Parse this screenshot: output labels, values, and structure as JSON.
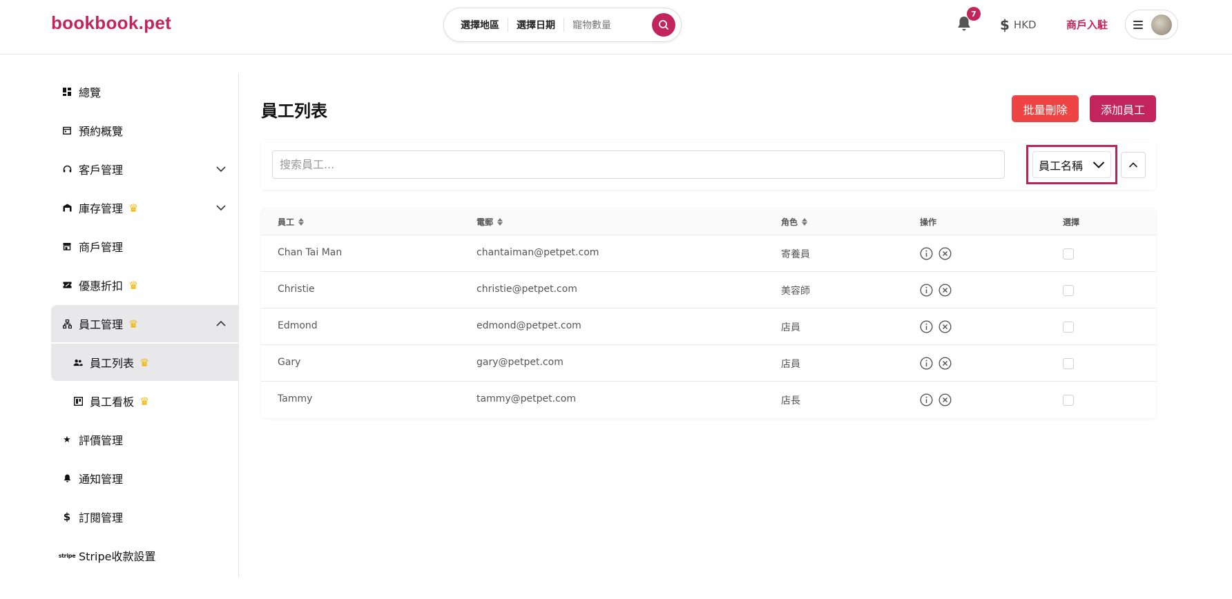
{
  "header": {
    "logo": "bookbook.pet",
    "search": {
      "region": "選擇地區",
      "date": "選擇日期",
      "pets": "寵物數量"
    },
    "notification_count": "7",
    "currency": "HKD",
    "merchant_link": "商戶入駐",
    "search_icon": "search-icon",
    "bell_icon": "bell-icon"
  },
  "sidebar": {
    "items": [
      {
        "label": "總覽",
        "icon": "dashboard-icon"
      },
      {
        "label": "預約概覽",
        "icon": "calendar-icon"
      },
      {
        "label": "客戶管理",
        "icon": "headset-icon"
      },
      {
        "label": "庫存管理",
        "icon": "warehouse-icon"
      },
      {
        "label": "商戶管理",
        "icon": "store-icon"
      },
      {
        "label": "優惠折扣",
        "icon": "ticket-icon"
      },
      {
        "label": "員工管理",
        "icon": "org-chart-icon"
      },
      {
        "label": "員工列表",
        "icon": "users-icon"
      },
      {
        "label": "員工看板",
        "icon": "board-icon"
      },
      {
        "label": "評價管理",
        "icon": "star-icon"
      },
      {
        "label": "通知管理",
        "icon": "bell-icon"
      },
      {
        "label": "訂閱管理",
        "icon": "dollar-icon"
      },
      {
        "label": "Stripe收款設置",
        "icon": "stripe-icon"
      }
    ]
  },
  "main": {
    "title": "員工列表",
    "bulk_delete_label": "批量刪除",
    "add_staff_label": "添加員工",
    "search_placeholder": "搜索員工...",
    "sort_field": "員工名稱",
    "columns": {
      "staff": "員工",
      "email": "電郵",
      "role": "角色",
      "actions": "操作",
      "select": "選擇"
    },
    "rows": [
      {
        "name": "Chan Tai Man",
        "email": "chantaiman@petpet.com",
        "role": "寄養員"
      },
      {
        "name": "Christie",
        "email": "christie@petpet.com",
        "role": "美容師"
      },
      {
        "name": "Edmond",
        "email": "edmond@petpet.com",
        "role": "店員"
      },
      {
        "name": "Gary",
        "email": "gary@petpet.com",
        "role": "店員"
      },
      {
        "name": "Tammy",
        "email": "tammy@petpet.com",
        "role": "店長"
      }
    ]
  },
  "colors": {
    "brand": "#c2255c",
    "danger": "#ef4444",
    "crown": "#f0b400",
    "active_bg": "#e8e8ea"
  }
}
